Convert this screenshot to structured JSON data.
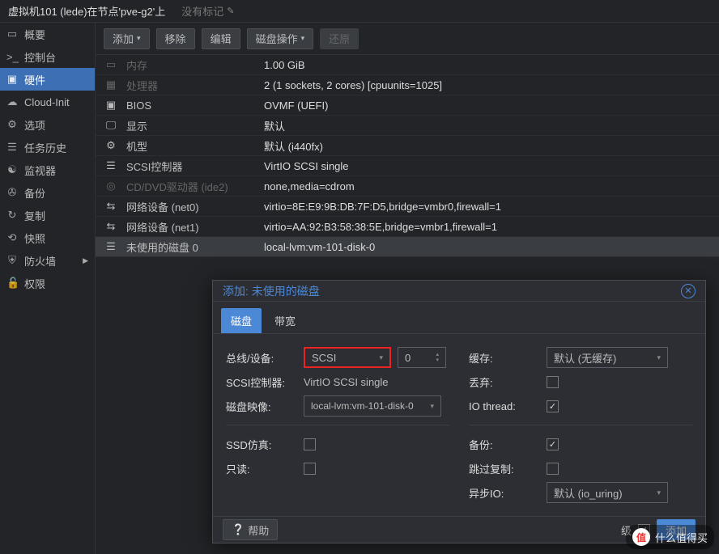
{
  "header": {
    "title": "虚拟机101 (lede)在节点'pve-g2'上",
    "no_tag": "没有标记"
  },
  "sidebar": {
    "items": [
      {
        "label": "概要",
        "icon": "book-icon"
      },
      {
        "label": "控制台",
        "icon": "terminal-icon"
      },
      {
        "label": "硬件",
        "icon": "chip-icon"
      },
      {
        "label": "Cloud-Init",
        "icon": "cloud-icon"
      },
      {
        "label": "选项",
        "icon": "gear-icon"
      },
      {
        "label": "任务历史",
        "icon": "list-icon"
      },
      {
        "label": "监视器",
        "icon": "eye-icon"
      },
      {
        "label": "备份",
        "icon": "save-icon"
      },
      {
        "label": "复制",
        "icon": "sync-icon"
      },
      {
        "label": "快照",
        "icon": "history-icon"
      },
      {
        "label": "防火墙",
        "icon": "shield-icon"
      },
      {
        "label": "权限",
        "icon": "lock-icon"
      }
    ]
  },
  "toolbar": {
    "add": "添加",
    "remove": "移除",
    "edit": "编辑",
    "disk_action": "磁盘操作",
    "revert": "还原"
  },
  "hardware": [
    {
      "icon": "memory-icon",
      "k": "内存",
      "v": "1.00 GiB",
      "dim": true
    },
    {
      "icon": "cpu-icon",
      "k": "处理器",
      "v": "2 (1 sockets, 2 cores) [cpuunits=1025]",
      "dim": true
    },
    {
      "icon": "chip-icon",
      "k": "BIOS",
      "v": "OVMF (UEFI)"
    },
    {
      "icon": "display-icon",
      "k": "显示",
      "v": "默认"
    },
    {
      "icon": "machine-icon",
      "k": "机型",
      "v": "默认 (i440fx)"
    },
    {
      "icon": "hdd-icon",
      "k": "SCSI控制器",
      "v": "VirtIO SCSI single"
    },
    {
      "icon": "disc-icon",
      "k": "CD/DVD驱动器 (ide2)",
      "v": "none,media=cdrom",
      "dim": true
    },
    {
      "icon": "net-icon",
      "k": "网络设备 (net0)",
      "v": "virtio=8E:E9:9B:DB:7F:D5,bridge=vmbr0,firewall=1"
    },
    {
      "icon": "net-icon",
      "k": "网络设备 (net1)",
      "v": "virtio=AA:92:B3:58:38:5E,bridge=vmbr1,firewall=1"
    },
    {
      "icon": "hdd-icon",
      "k": "未使用的磁盘 0",
      "v": "local-lvm:vm-101-disk-0",
      "sel": true
    }
  ],
  "dialog": {
    "title": "添加: 未使用的磁盘",
    "tabs": {
      "disk": "磁盘",
      "bandwidth": "带宽"
    },
    "left": {
      "bus_label": "总线/设备:",
      "bus_value": "SCSI",
      "bus_index": "0",
      "scsi_ctrl_label": "SCSI控制器:",
      "scsi_ctrl_value": "VirtIO SCSI single",
      "disk_image_label": "磁盘映像:",
      "disk_image_value": "local-lvm:vm-101-disk-0",
      "ssd_label": "SSD仿真:",
      "ssd_checked": false,
      "ro_label": "只读:",
      "ro_checked": false
    },
    "right": {
      "cache_label": "缓存:",
      "cache_value": "默认 (无缓存)",
      "discard_label": "丢弃:",
      "discard_checked": false,
      "iothread_label": "IO thread:",
      "iothread_checked": true,
      "backup_label": "备份:",
      "backup_checked": true,
      "skiprep_label": "跳过复制:",
      "skiprep_checked": false,
      "asyncio_label": "异步IO:",
      "asyncio_value": "默认 (io_uring)"
    },
    "footer": {
      "help": "帮助",
      "advanced": "级",
      "add": "添加"
    }
  },
  "watermark": "什么值得买"
}
